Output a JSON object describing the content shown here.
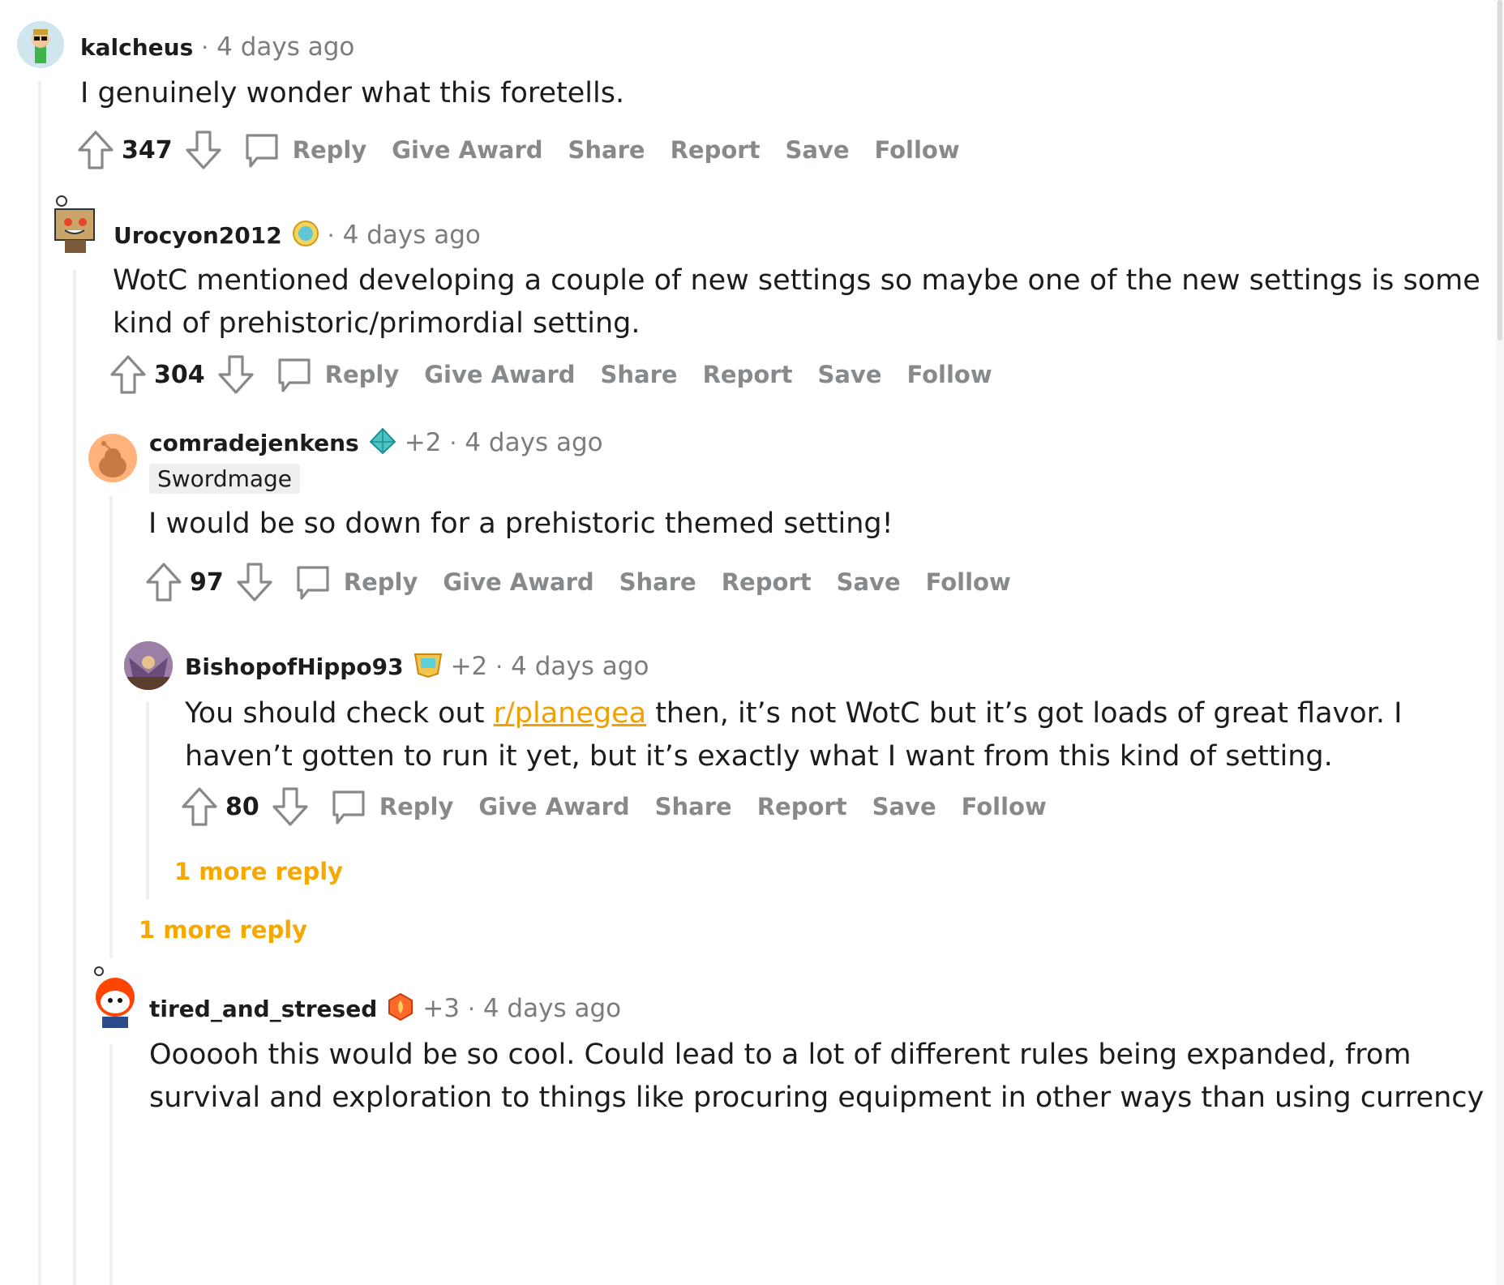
{
  "comments": [
    {
      "user": "kalcheus",
      "time": "4 days ago",
      "lines": [
        "I genuinely wonder what this foretells."
      ],
      "score": "347"
    },
    {
      "user": "Urocyon2012",
      "time": "4 days ago",
      "lines": [
        "WotC mentioned developing a couple of new settings so maybe one of the new settings is some",
        "kind of prehistoric/primordial setting."
      ],
      "score": "304"
    },
    {
      "user": "comradejenkens",
      "extra": "+2",
      "time": "4 days ago",
      "flair": "Swordmage",
      "lines": [
        "I would be so down for a prehistoric themed setting!"
      ],
      "score": "97"
    },
    {
      "user": "BishopofHippo93",
      "extra": "+2",
      "time": "4 days ago",
      "line1_pre": "You should check out ",
      "link": "r/planegea",
      "line1_post": " then, it’s not WotC but it’s got loads of great flavor. I",
      "line2": "haven’t gotten to run it yet, but it’s exactly what I want from this kind of setting.",
      "score": "80"
    },
    {
      "user": "tired_and_stresed",
      "extra": "+3",
      "time": "4 days ago",
      "lines": [
        "Oooooh this would be so cool. Could lead to a lot of different rules being expanded, from",
        "survival and exploration to things like procuring equipment in other ways than using currency"
      ]
    }
  ],
  "actions": {
    "reply": "Reply",
    "give_award": "Give Award",
    "share": "Share",
    "report": "Report",
    "save": "Save",
    "follow": "Follow"
  },
  "more_replies": {
    "inner": "1 more reply",
    "outer": "1 more reply"
  },
  "dot": "·",
  "colors": {
    "link": "#f0a000",
    "more_reply": "#f5a800",
    "action_gray": "#878a8c",
    "thread_line": "#edeff1"
  },
  "icons": [
    "upvote-icon",
    "downvote-icon",
    "comment-bubble-icon",
    "award-badge-icon"
  ]
}
